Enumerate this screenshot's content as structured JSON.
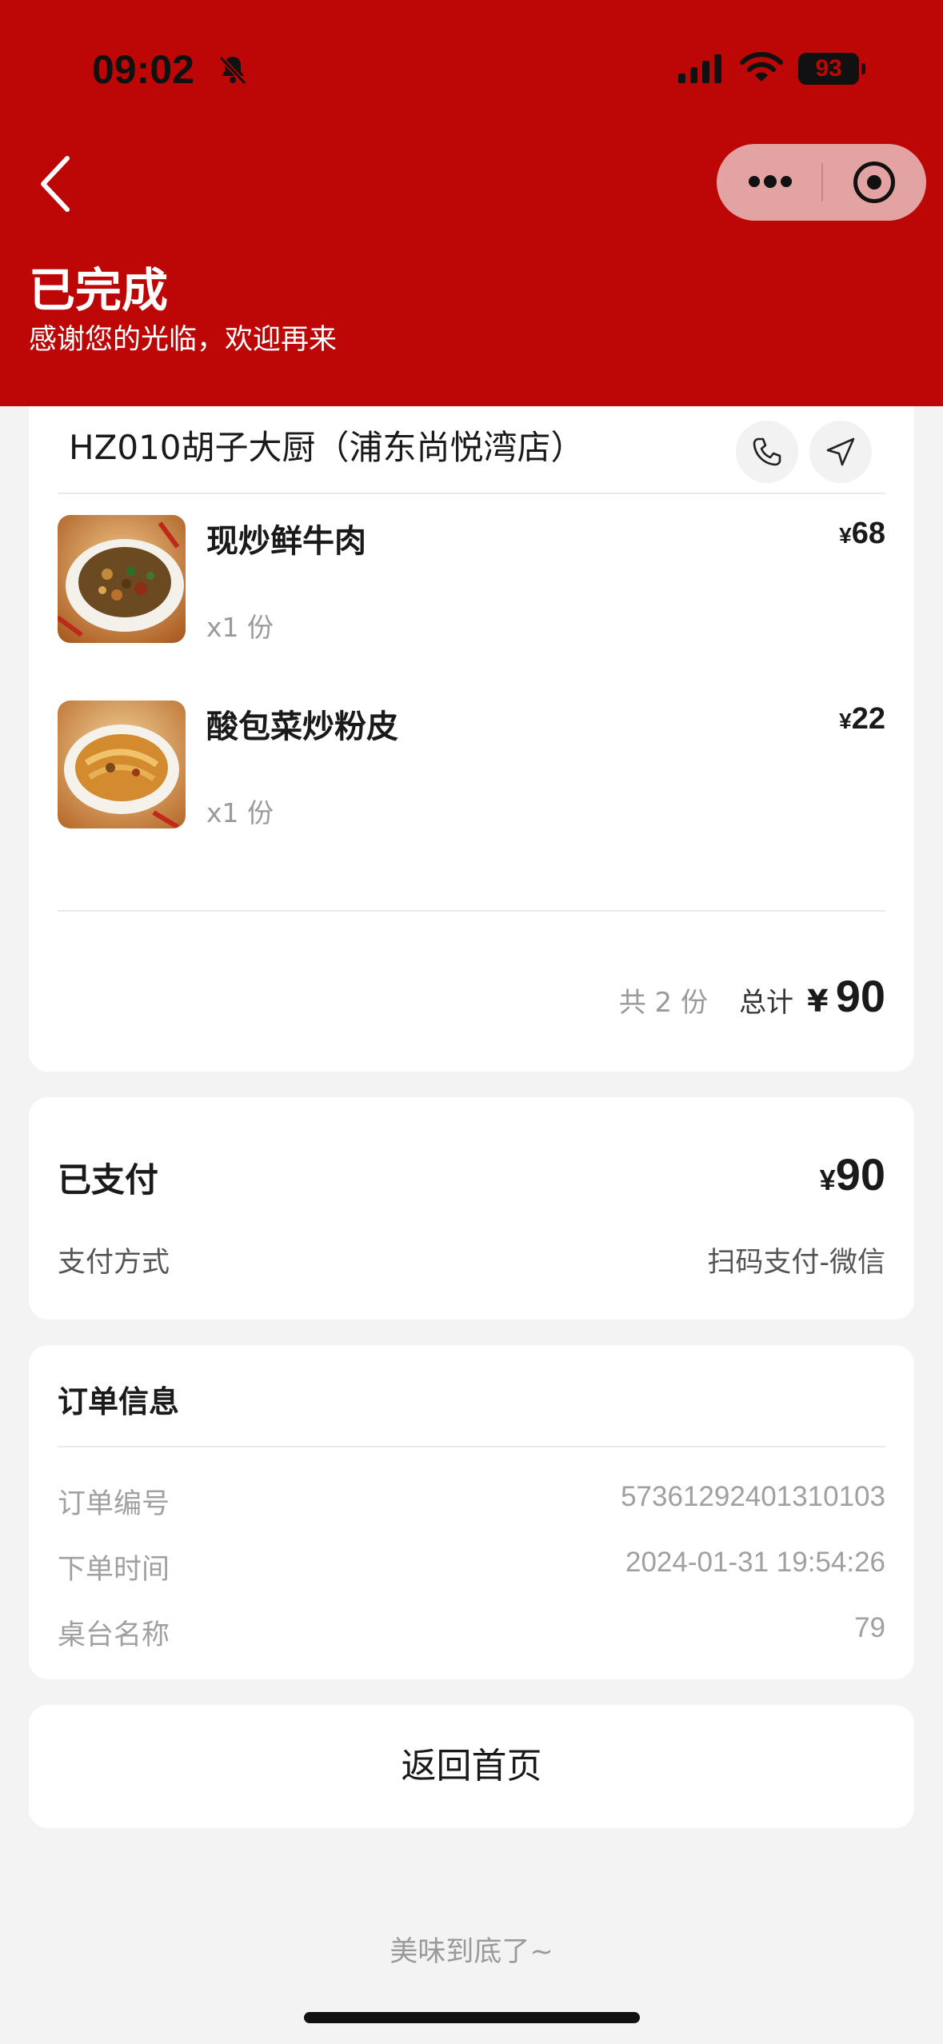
{
  "status_bar": {
    "time": "09:02",
    "battery": "93",
    "icons": [
      "bell-slash-icon",
      "signal-icon",
      "wifi-icon",
      "battery-icon"
    ]
  },
  "header": {
    "title": "已完成",
    "subtitle": "感谢您的光临，欢迎再来",
    "background_color": "#bd0606",
    "icons": [
      "back-arrow-icon",
      "more-dots-icon",
      "target-icon"
    ]
  },
  "order": {
    "store_name": "HZ010胡子大厨（浦东尚悦湾店）",
    "store_icons": [
      "phone-icon",
      "navigation-icon"
    ],
    "items": [
      {
        "name": "现炒鲜牛肉",
        "quantity": "x1 份",
        "currency": "¥",
        "price": "68",
        "image": "stir-fried-beef-image"
      },
      {
        "name": "酸包菜炒粉皮",
        "quantity": "x1 份",
        "currency": "¥",
        "price": "22",
        "image": "cabbage-noodles-image"
      }
    ],
    "summary": {
      "count_text": "共 2 份",
      "total_label": "总计",
      "currency": "¥",
      "total": "90"
    }
  },
  "payment": {
    "status": "已支付",
    "currency": "¥",
    "amount": "90",
    "method_label": "支付方式",
    "method_value": "扫码支付-微信"
  },
  "order_info": {
    "title": "订单信息",
    "rows": [
      {
        "label": "订单编号",
        "value": "57361292401310103"
      },
      {
        "label": "下单时间",
        "value": "2024-01-31 19:54:26"
      },
      {
        "label": "桌台名称",
        "value": "79"
      }
    ]
  },
  "actions": {
    "home_button": "返回首页"
  },
  "footer": {
    "note": "美味到底了~"
  }
}
